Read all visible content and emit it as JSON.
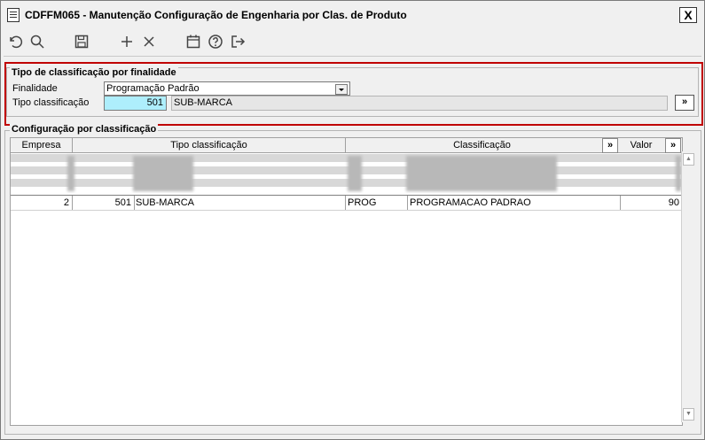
{
  "window": {
    "title": "CDFFM065 - Manutenção Configuração de Engenharia por Clas. de Produto",
    "close_label": "X"
  },
  "toolbar": {
    "icons": [
      "undo-icon",
      "search-icon",
      "save-icon",
      "add-icon",
      "delete-icon",
      "calendar-icon",
      "help-icon",
      "exit-icon"
    ]
  },
  "filter_group": {
    "legend": "Tipo de classificação por finalidade",
    "finalidade_label": "Finalidade",
    "finalidade_value": "Programação Padrão",
    "tipo_label": "Tipo classificação",
    "tipo_code": "501",
    "tipo_desc": "SUB-MARCA",
    "more_label": "»"
  },
  "config_group": {
    "legend": "Configuração por classificação",
    "columns": [
      "Empresa",
      "Tipo classificação",
      "Classificação",
      "Valor"
    ],
    "more_label": "»",
    "rows": [
      {
        "empresa": "2",
        "tipo_code": "501",
        "tipo_desc": "SUB-MARCA",
        "class_code": "PROG",
        "class_desc": "PROGRAMACAO PADRAO",
        "valor": "90"
      }
    ]
  },
  "colors": {
    "accent_border": "#c00000",
    "code_field": "#aeeefc"
  }
}
